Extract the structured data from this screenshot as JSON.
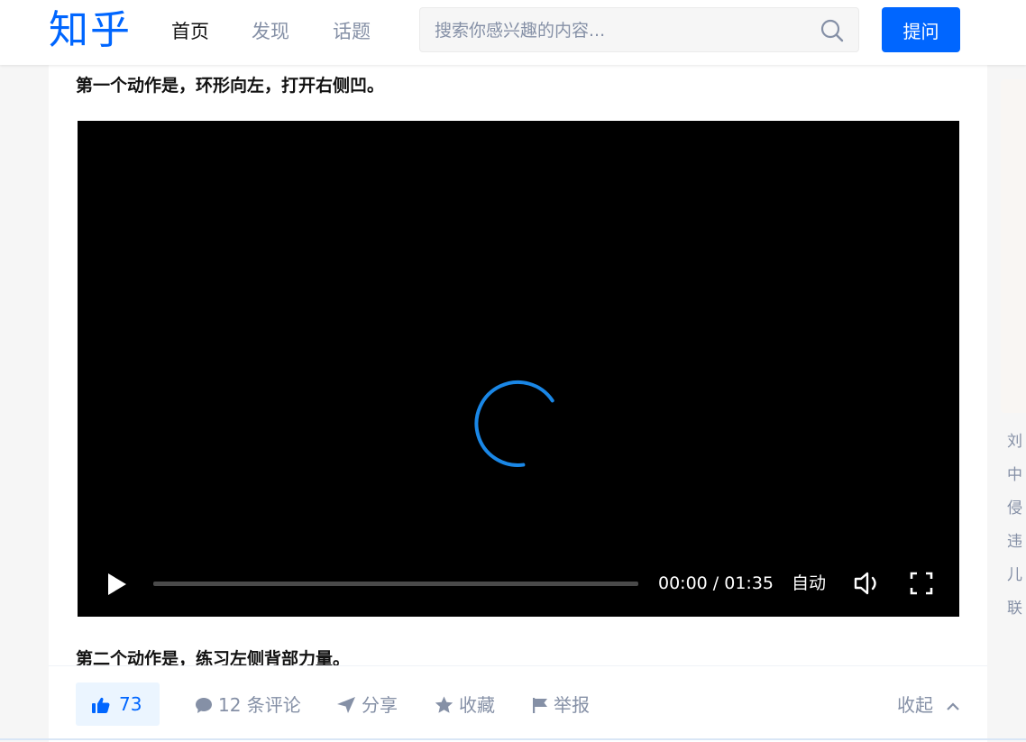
{
  "header": {
    "logo": "知乎",
    "nav": [
      {
        "label": "首页",
        "active": true
      },
      {
        "label": "发现",
        "active": false
      },
      {
        "label": "话题",
        "active": false
      }
    ],
    "search": {
      "placeholder": "搜索你感兴趣的内容...",
      "value": ""
    },
    "ask_label": "提问"
  },
  "content": {
    "paragraph_1": "第一个动作是，环形向左，打开右侧凹。",
    "paragraph_2": "第二个动作是，练习左侧背部力量。",
    "video": {
      "state": "loading",
      "current_time": "00:00",
      "separator": " / ",
      "duration": "01:35",
      "progress": 0,
      "auto_label": "自动"
    }
  },
  "actions": {
    "vote_count": "73",
    "comments_label": "12 条评论",
    "share_label": "分享",
    "favorite_label": "收藏",
    "report_label": "举报",
    "collapse_label": "收起"
  },
  "sidebar": {
    "links": [
      "刘",
      "中",
      "侵",
      "违",
      "儿",
      "联"
    ]
  },
  "colors": {
    "brand": "#0066ff",
    "muted": "#8590a6",
    "text": "#121212"
  },
  "icons": [
    "search-icon",
    "play-icon",
    "volume-icon",
    "fullscreen-icon",
    "thumbs-up-icon",
    "comment-icon",
    "share-icon",
    "star-icon",
    "flag-icon",
    "chevron-up-icon",
    "loading-spinner-icon"
  ]
}
